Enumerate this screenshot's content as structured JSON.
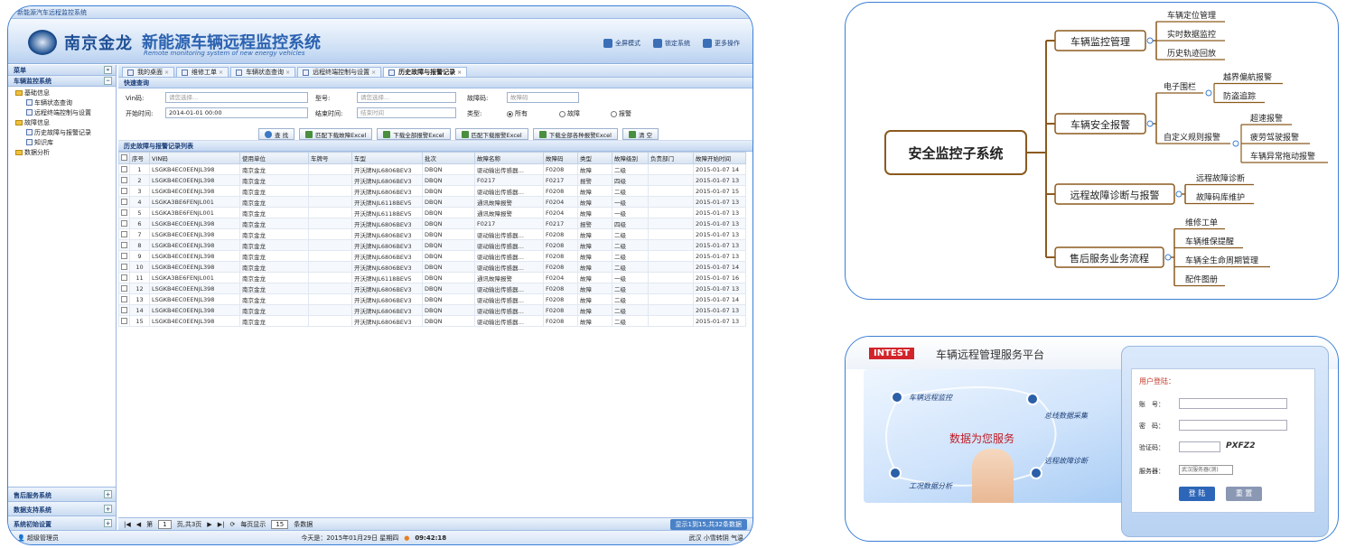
{
  "app": {
    "window_title": "新能源汽车远程监控系统",
    "brand": "南京金龙",
    "system_title": "新能源车辆远程监控系统",
    "system_subtitle": "Remote monitoring system of new energy vehicles",
    "header_buttons": [
      "全屏模式",
      "锁定系统",
      "更多操作"
    ],
    "sidebar": {
      "menu_label": "菜单",
      "section": "车辆监控系统",
      "tree": [
        {
          "label": "基础信息",
          "level": 1,
          "type": "folder"
        },
        {
          "label": "车辆状态查询",
          "level": 2,
          "type": "leaf"
        },
        {
          "label": "远程终端控制与设置",
          "level": 2,
          "type": "leaf"
        },
        {
          "label": "故障信息",
          "level": 1,
          "type": "folder"
        },
        {
          "label": "历史故障与报警记录",
          "level": 2,
          "type": "leaf"
        },
        {
          "label": "知识库",
          "level": 2,
          "type": "leaf"
        },
        {
          "label": "数据分析",
          "level": 1,
          "type": "folder"
        }
      ],
      "footer_sections": [
        "售后服务系统",
        "数据支持系统",
        "系统初始设置"
      ]
    },
    "tabs": [
      "我的桌面",
      "维修工单",
      "车辆状态查询",
      "远程终端控制与设置",
      "历史故障与报警记录"
    ],
    "active_tab": 4,
    "quick_query": {
      "title": "快速查询",
      "vin_label": "Vin码:",
      "vin_placeholder": "请您选择...",
      "type_label": "型号:",
      "type_placeholder": "请您选择...",
      "fault_label": "故障码:",
      "fault_placeholder": "故障码",
      "start_label": "开始时间:",
      "start_value": "2014-01-01 00:00",
      "end_label": "结束时间:",
      "end_placeholder": "结束时间",
      "kind_label": "类型:",
      "radios": [
        "所有",
        "故障",
        "报警"
      ],
      "buttons": [
        "查 找",
        "匹配下载故障Excel",
        "下载全部报警Excel",
        "匹配下载报警Excel",
        "下载全部各种报警Excel",
        "清 空"
      ]
    },
    "table": {
      "title": "历史故障与报警记录列表",
      "columns": [
        "序号",
        "VIN码",
        "使用单位",
        "车牌号",
        "车型",
        "批次",
        "故障名称",
        "故障码",
        "类型",
        "故障级别",
        "负责部门",
        "故障开始时间"
      ],
      "rows": [
        [
          "1",
          "LSGKB4EC0EENJL398",
          "南京金龙",
          "",
          "开沃牌NJL6806BEV3",
          "DBQN",
          "驱动输出传感器…",
          "F0208",
          "故障",
          "二级",
          "",
          "2015-01-07 14"
        ],
        [
          "2",
          "LSGKB4EC0EENJL398",
          "南京金龙",
          "",
          "开沃牌NJL6806BEV3",
          "DBQN",
          "F0217",
          "F0217",
          "报警",
          "四级",
          "",
          "2015-01-07 13"
        ],
        [
          "3",
          "LSGKB4EC0EENJL398",
          "南京金龙",
          "",
          "开沃牌NJL6806BEV3",
          "DBQN",
          "驱动输出传感器…",
          "F0208",
          "故障",
          "二级",
          "",
          "2015-01-07 15"
        ],
        [
          "4",
          "LSGKA3BE6FENJL001",
          "南京金龙",
          "",
          "开沃牌NJL6118BEV5",
          "DBQN",
          "通讯故障报警",
          "F0204",
          "故障",
          "一级",
          "",
          "2015-01-07 13"
        ],
        [
          "5",
          "LSGKA3BE6FENJL001",
          "南京金龙",
          "",
          "开沃牌NJL6118BEV5",
          "DBQN",
          "通讯故障报警",
          "F0204",
          "故障",
          "一级",
          "",
          "2015-01-07 13"
        ],
        [
          "6",
          "LSGKB4EC0EENJL398",
          "南京金龙",
          "",
          "开沃牌NJL6806BEV3",
          "DBQN",
          "F0217",
          "F0217",
          "报警",
          "四级",
          "",
          "2015-01-07 13"
        ],
        [
          "7",
          "LSGKB4EC0EENJL398",
          "南京金龙",
          "",
          "开沃牌NJL6806BEV3",
          "DBQN",
          "驱动输出传感器…",
          "F0208",
          "故障",
          "二级",
          "",
          "2015-01-07 13"
        ],
        [
          "8",
          "LSGKB4EC0EENJL398",
          "南京金龙",
          "",
          "开沃牌NJL6806BEV3",
          "DBQN",
          "驱动输出传感器…",
          "F0208",
          "故障",
          "二级",
          "",
          "2015-01-07 13"
        ],
        [
          "9",
          "LSGKB4EC0EENJL398",
          "南京金龙",
          "",
          "开沃牌NJL6806BEV3",
          "DBQN",
          "驱动输出传感器…",
          "F0208",
          "故障",
          "二级",
          "",
          "2015-01-07 13"
        ],
        [
          "10",
          "LSGKB4EC0EENJL398",
          "南京金龙",
          "",
          "开沃牌NJL6806BEV3",
          "DBQN",
          "驱动输出传感器…",
          "F0208",
          "故障",
          "二级",
          "",
          "2015-01-07 14"
        ],
        [
          "11",
          "LSGKA3BE6FENJL001",
          "南京金龙",
          "",
          "开沃牌NJL6118BEV5",
          "DBQN",
          "通讯故障报警",
          "F0204",
          "故障",
          "一级",
          "",
          "2015-01-07 16"
        ],
        [
          "12",
          "LSGKB4EC0EENJL398",
          "南京金龙",
          "",
          "开沃牌NJL6806BEV3",
          "DBQN",
          "驱动输出传感器…",
          "F0208",
          "故障",
          "二级",
          "",
          "2015-01-07 13"
        ],
        [
          "13",
          "LSGKB4EC0EENJL398",
          "南京金龙",
          "",
          "开沃牌NJL6806BEV3",
          "DBQN",
          "驱动输出传感器…",
          "F0208",
          "故障",
          "二级",
          "",
          "2015-01-07 14"
        ],
        [
          "14",
          "LSGKB4EC0EENJL398",
          "南京金龙",
          "",
          "开沃牌NJL6806BEV3",
          "DBQN",
          "驱动输出传感器…",
          "F0208",
          "故障",
          "二级",
          "",
          "2015-01-07 13"
        ],
        [
          "15",
          "LSGKB4EC0EENJL398",
          "南京金龙",
          "",
          "开沃牌NJL6806BEV3",
          "DBQN",
          "驱动输出传感器…",
          "F0208",
          "故障",
          "二级",
          "",
          "2015-01-07 13"
        ]
      ]
    },
    "pager": {
      "page_label": "第",
      "page": "1",
      "of_label": "页,共3页",
      "per_page_label": "每页显示",
      "per_page": "15",
      "records_label": "条数据",
      "info": "显示1到15,共32条数据"
    },
    "status": {
      "user": "超级管理员",
      "date": "今天是：2015年01月29日 星期四",
      "time": "09:42:18",
      "weather": "武汉 小雪转阴 气温"
    }
  },
  "mindmap": {
    "root": "安全监控子系统",
    "branches": [
      {
        "label": "车辆监控管理",
        "children": [
          "车辆定位管理",
          "实时数据监控",
          "历史轨迹回放"
        ]
      },
      {
        "label": "车辆安全报警",
        "groups": [
          {
            "label": "电子围栏",
            "children": [
              "越界偏航报警",
              "防盗追踪"
            ]
          },
          {
            "label": "自定义规则报警",
            "children": [
              "超速报警",
              "疲劳驾驶报警",
              "车辆异常拖动报警"
            ]
          }
        ]
      },
      {
        "label": "远程故障诊断与报警",
        "children": [
          "远程故障诊断",
          "故障码库维护"
        ]
      },
      {
        "label": "售后服务业务流程",
        "children": [
          "维修工单",
          "车辆维保提醒",
          "车辆全生命周期管理",
          "配件图册"
        ]
      }
    ]
  },
  "login": {
    "logo": "INTEST",
    "title": "车辆远程管理服务平台",
    "hero_captions": [
      "车辆远程监控",
      "总线数据采集",
      "远程故障诊断",
      "工况数据分析"
    ],
    "slogan": "数据为您服务",
    "form_title": "用户登陆：",
    "account_label": "账　号：",
    "password_label": "密　码：",
    "captcha_label": "验证码：",
    "captcha_value": "PXFZ2",
    "server_label": "服务器：",
    "server_value": "武汉服务器(测)",
    "login_button": "登 陆",
    "reset_button": "重 置",
    "colors": {
      "brand_red": "#d2232a",
      "login_blue": "#2d66b8"
    }
  }
}
